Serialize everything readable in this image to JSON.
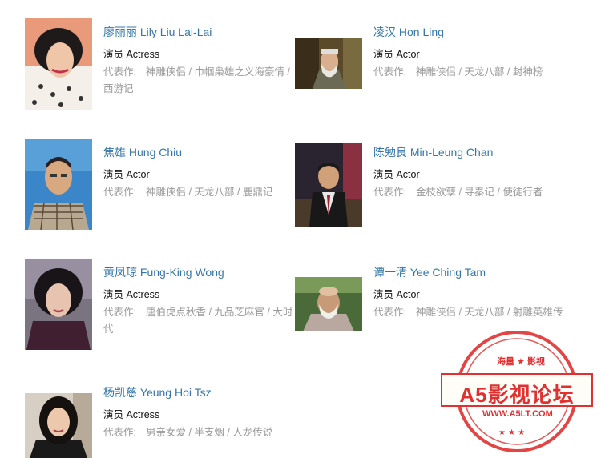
{
  "works_label": "代表作:",
  "celebrities": [
    {
      "name": "廖丽丽 Lily Liu Lai-Lai",
      "role": "演员 Actress",
      "works": [
        "神雕侠侣",
        "巾帼枭雄之义海豪情",
        "西游记"
      ]
    },
    {
      "name": "凌汉 Hon Ling",
      "role": "演员 Actor",
      "works": [
        "神雕侠侣",
        "天龙八部",
        "封神榜"
      ]
    },
    {
      "name": "焦雄 Hung Chiu",
      "role": "演员 Actor",
      "works": [
        "神雕侠侣",
        "天龙八部",
        "鹿鼎记"
      ]
    },
    {
      "name": "陈勉良 Min-Leung Chan",
      "role": "演员 Actor",
      "works": [
        "金枝欲孽",
        "寻秦记",
        "使徒行者"
      ]
    },
    {
      "name": "黄凤琼 Fung-King Wong",
      "role": "演员 Actress",
      "works": [
        "唐伯虎点秋香",
        "九品芝麻官",
        "大时代"
      ]
    },
    {
      "name": "谭一清 Yee Ching Tam",
      "role": "演员 Actor",
      "works": [
        "神雕侠侣",
        "天龙八部",
        "射雕英雄传"
      ]
    },
    {
      "name": "杨凯慈 Yeung Hoi Tsz",
      "role": "演员 Actress",
      "works": [
        "男亲女爱",
        "半支烟",
        "人龙传说"
      ]
    }
  ],
  "stamp": {
    "top": "海量 ★ 影视",
    "main": "A5影视论坛",
    "url": "WWW.A5LT.COM",
    "color": "#e03030"
  },
  "colors": {
    "name_link": "#3377aa",
    "role": "#111111",
    "works": "#999999"
  }
}
